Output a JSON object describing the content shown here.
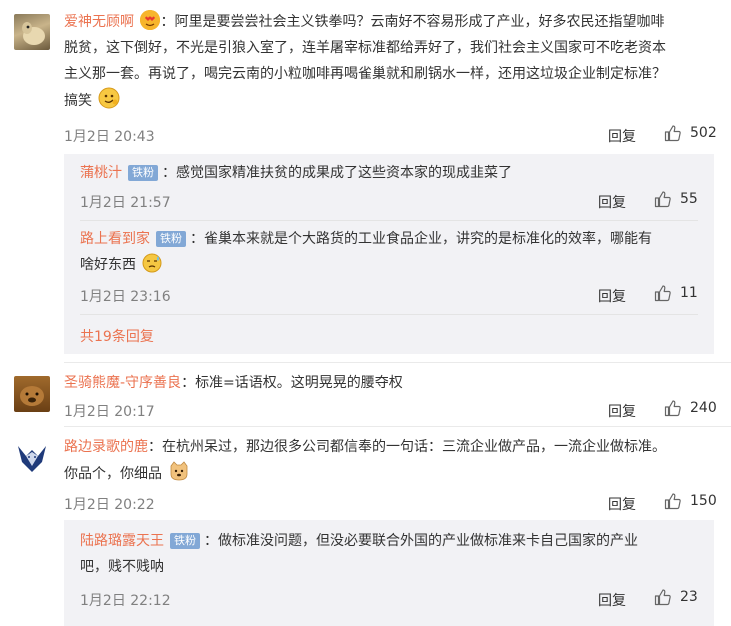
{
  "comments": [
    {
      "user": "爱神无顾啊",
      "text_l1": "阿里是要尝尝社会主义铁拳吗？云南好不容易形成了产业，好多农民还指望咖啡",
      "text_l2": "脱贫，这下倒好，不光是引狼入室了，连羊屠宰标准都给弄好了，我们社会主义国家可不吃老资本",
      "text_l3": "主义那一套。再说了，喝完云南的小粒咖啡再喝雀巢就和刷锅水一样，还用这垃圾企业制定标准？",
      "text_l4": "搞笑",
      "time": "1月2日 20:43",
      "reply_label": "回复",
      "likes": "502",
      "replies": [
        {
          "user": "蒲桃汁",
          "badge": "铁粉",
          "text_l1": "感觉国家精准扶贫的成果成了这些资本家的现成韭菜了",
          "time": "1月2日 21:57",
          "reply_label": "回复",
          "likes": "55"
        },
        {
          "user": "路上看到家",
          "badge": "铁粉",
          "text_l1": "雀巢本来就是个大路货的工业食品企业，讲究的是标准化的效率，哪能有",
          "text_l2": "啥好东西",
          "time": "1月2日 23:16",
          "reply_label": "回复",
          "likes": "11"
        }
      ],
      "more_replies": "共19条回复"
    },
    {
      "user": "圣骑熊魔-守序善良",
      "text_l1": "标准=话语权。这明晃晃的腰夺权",
      "time": "1月2日 20:17",
      "reply_label": "回复",
      "likes": "240"
    },
    {
      "user": "路边录歌的鹿",
      "text_l1": "在杭州呆过，那边很多公司都信奉的一句话：三流企业做产品，一流企业做标准。",
      "text_l2": "你品个，你细品",
      "time": "1月2日 20:22",
      "reply_label": "回复",
      "likes": "150",
      "replies": [
        {
          "user": "陆路璐露天王",
          "badge": "铁粉",
          "text_l1": "做标准没问题，但没必要联合外国的产业做标准来卡自己国家的产业",
          "text_l2": "吧，贱不贱呐",
          "time": "1月2日 22:12",
          "reply_label": "回复",
          "likes": "23"
        }
      ]
    }
  ]
}
